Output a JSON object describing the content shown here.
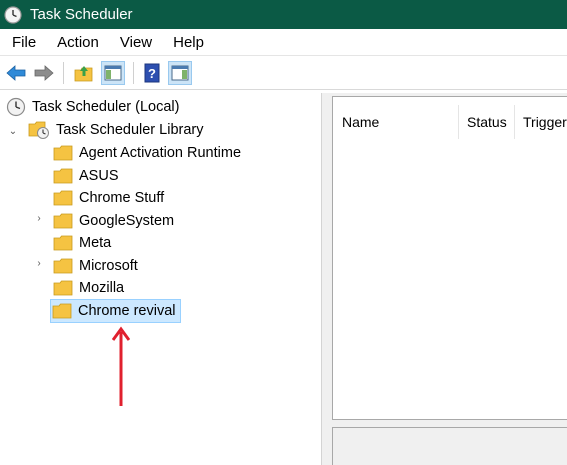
{
  "window": {
    "title": "Task Scheduler",
    "app_icon": "clock-icon"
  },
  "menu": [
    "File",
    "Action",
    "View",
    "Help"
  ],
  "toolbar": {
    "buttons": [
      "back-arrow-icon",
      "forward-arrow-icon",
      "up-folder-icon",
      "show-hide-console-tree-icon",
      "help-icon",
      "show-hide-action-pane-icon"
    ]
  },
  "tree": {
    "root": "Task Scheduler (Local)",
    "library": "Task Scheduler Library",
    "folders": [
      {
        "label": "Agent Activation Runtime",
        "expandable": false
      },
      {
        "label": "ASUS",
        "expandable": false
      },
      {
        "label": "Chrome Stuff",
        "expandable": false
      },
      {
        "label": "GoogleSystem",
        "expandable": true
      },
      {
        "label": "Meta",
        "expandable": false
      },
      {
        "label": "Microsoft",
        "expandable": true
      },
      {
        "label": "Mozilla",
        "expandable": false
      },
      {
        "label": "Chrome revival",
        "expandable": false,
        "selected": true
      }
    ]
  },
  "task_list": {
    "columns": [
      "Name",
      "Status",
      "Triggers"
    ]
  },
  "annotation": {
    "type": "red-up-arrow",
    "color": "#e0202e",
    "points_to": "Chrome revival"
  },
  "colors": {
    "titlebar": "#0b5a45",
    "selection": "#cce8ff",
    "folder": "#f5c342"
  }
}
